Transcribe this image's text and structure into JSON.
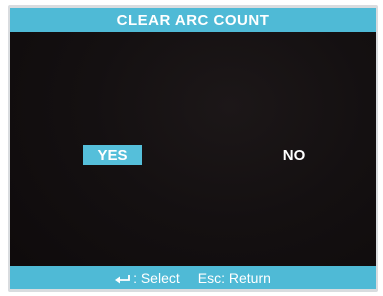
{
  "title": "CLEAR ARC COUNT",
  "options": {
    "yes_label": "YES",
    "no_label": "NO",
    "selected": "YES"
  },
  "footer": {
    "select_key_icon": "enter-icon",
    "select_label": ": Select",
    "return_key_label": "Esc",
    "return_label": ": Return"
  },
  "colors": {
    "accent": "#4fbad6",
    "selection": "#55bfda",
    "screen_background": "#120d0e",
    "text": "#ffffff"
  }
}
